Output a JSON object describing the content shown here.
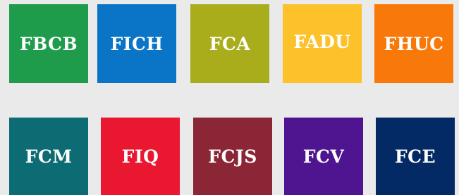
{
  "tiles": [
    {
      "label": "FBCB",
      "color": "#1e9c4b"
    },
    {
      "label": "FICH",
      "color": "#0a75c6"
    },
    {
      "label": "FCA",
      "color": "#a9ad1c"
    },
    {
      "label": "FADU",
      "color": "#fdc12a"
    },
    {
      "label": "FHUC",
      "color": "#f8790a"
    },
    {
      "label": "FCM",
      "color": "#0d6b73"
    },
    {
      "label": "FIQ",
      "color": "#ea1730"
    },
    {
      "label": "FCJS",
      "color": "#8b2636"
    },
    {
      "label": "FCV",
      "color": "#4f1490"
    },
    {
      "label": "FCE",
      "color": "#032a64"
    }
  ]
}
